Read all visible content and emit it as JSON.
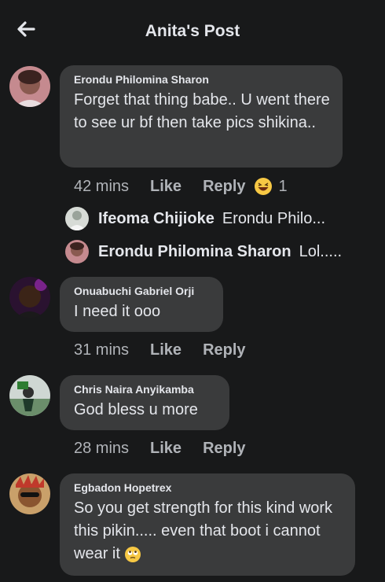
{
  "header": {
    "title": "Anita's Post"
  },
  "comments": [
    {
      "author": "Erondu Philomina Sharon",
      "text": "Forget that thing babe.. U went there to see ur bf then take pics shikina..",
      "time": "42 mins",
      "like": "Like",
      "reply": "Reply",
      "reaction_count": "1",
      "replies": [
        {
          "author": "Ifeoma Chijioke",
          "snippet": "Erondu Philo..."
        },
        {
          "author": "Erondu Philomina Sharon",
          "snippet": "Lol....."
        }
      ]
    },
    {
      "author": "Onuabuchi Gabriel Orji",
      "text": "I need it ooo",
      "time": "31 mins",
      "like": "Like",
      "reply": "Reply"
    },
    {
      "author": "Chris Naira Anyikamba",
      "text": "God bless u more",
      "time": "28 mins",
      "like": "Like",
      "reply": "Reply"
    },
    {
      "author": "Egbadon Hopetrex",
      "text": "So you get strength for this kind work this pikin..... even that boot i cannot wear it",
      "time": "",
      "like": "",
      "reply": ""
    }
  ],
  "icons": {
    "back": "back-arrow-icon",
    "reaction": "laughing-emoji-icon",
    "eyeroll": "eye-roll-emoji-icon"
  }
}
